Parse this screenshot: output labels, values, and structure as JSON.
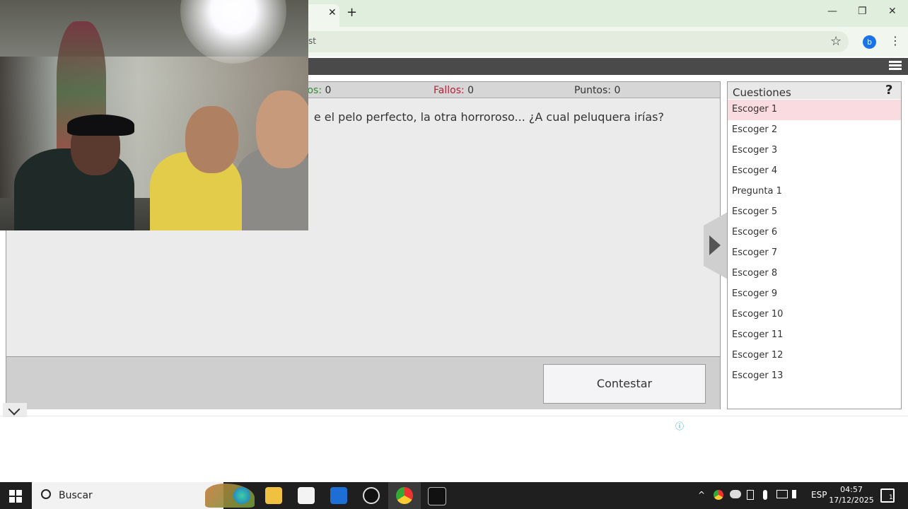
{
  "browser": {
    "tab_title": "s c",
    "url": "st",
    "profile_letter": "b",
    "close_tab": "✕",
    "new_tab": "+",
    "minimize": "—",
    "restore": "❐",
    "close_window": "✕",
    "star": "☆",
    "menu": "⋮"
  },
  "score": {
    "aciertos_label": "tos:",
    "aciertos_value": "0",
    "fallos_label": "Fallos:",
    "fallos_value": "0",
    "puntos_label": "Puntos:",
    "puntos_value": "0"
  },
  "question_text": "e el pelo perfecto, la otra horroroso... ¿A cual peluquera irías?",
  "contestar_label": "Contestar",
  "panel": {
    "title": "Cuestiones",
    "help": "?",
    "items": [
      "Escoger 1",
      "Escoger 2",
      "Escoger 3",
      "Escoger 4",
      "Pregunta 1",
      "Escoger 5",
      "Escoger 6",
      "Escoger 7",
      "Escoger 8",
      "Escoger 9",
      "Escoger 10",
      "Escoger 11",
      "Escoger 12",
      "Escoger 13"
    ],
    "active_index": 0
  },
  "info_icon": "ⓘ",
  "taskbar": {
    "search_placeholder": "Buscar",
    "language": "ESP",
    "time": "04:57",
    "date": "17/12/2025",
    "notification_count": "1"
  },
  "colors": {
    "aciertos": "#3a8a3a",
    "fallos": "#b0223a",
    "active_item": "#fadbe0"
  }
}
